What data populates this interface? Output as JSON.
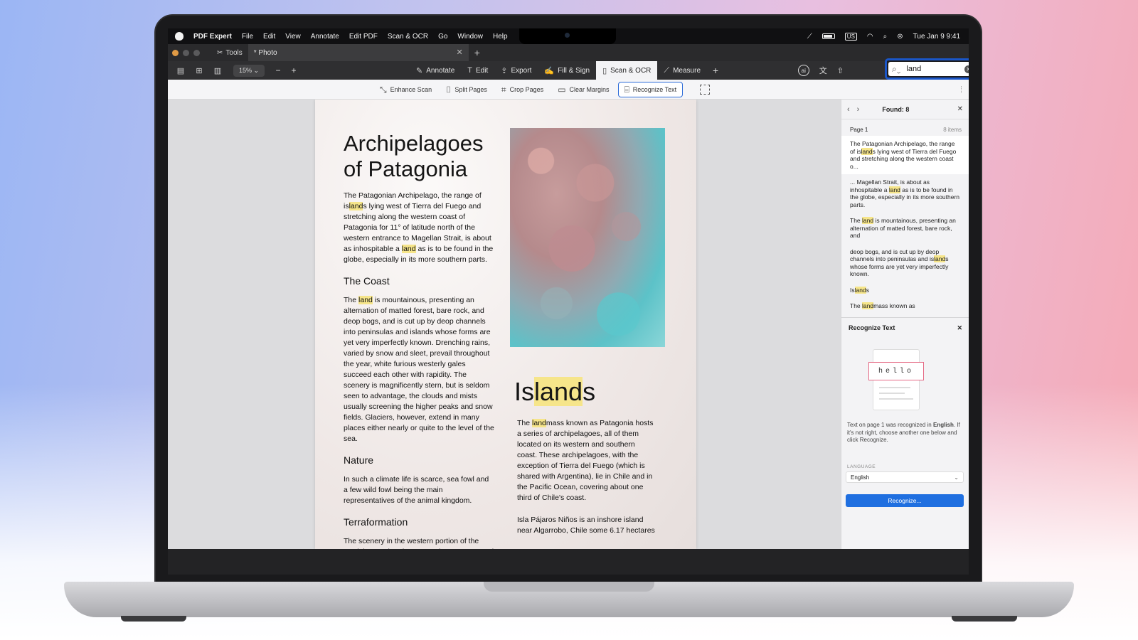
{
  "menubar": {
    "app_name": "PDF Expert",
    "items": [
      "File",
      "Edit",
      "View",
      "Annotate",
      "Edit PDF",
      "Scan & OCR",
      "Go",
      "Window",
      "Help"
    ],
    "keyboard_lang": "US",
    "clock": "Tue Jan 9  9:41"
  },
  "tabs": {
    "tools_label": "Tools",
    "doc_label": "* Photo"
  },
  "toolbar": {
    "zoom": "15%",
    "modes": [
      {
        "label": "Annotate",
        "icon": "pen-icon"
      },
      {
        "label": "Edit",
        "icon": "text-cursor-icon"
      },
      {
        "label": "Export",
        "icon": "upload-icon"
      },
      {
        "label": "Fill & Sign",
        "icon": "signature-icon"
      },
      {
        "label": "Scan & OCR",
        "icon": "scan-icon"
      },
      {
        "label": "Measure",
        "icon": "ruler-icon"
      }
    ],
    "active_mode": "Scan & OCR"
  },
  "search": {
    "value": "land"
  },
  "scan_tools": [
    {
      "label": "Enhance Scan"
    },
    {
      "label": "Split Pages"
    },
    {
      "label": "Crop Pages"
    },
    {
      "label": "Clear Margins"
    },
    {
      "label": "Recognize Text"
    }
  ],
  "document": {
    "title_line1": "Archipelagoes",
    "title_line2": "of Patagonia",
    "intro_a": "The Patagonian Archipelago, the range of is",
    "intro_hl": "land",
    "intro_b": "s lying west of Tierra del Fuego and stretching along the western coast of Patagonia for 11° of latitude north of the western entrance to Magellan Strait, is about as inhospitable a ",
    "intro_hl2": "land",
    "intro_c": " as is to be found in the globe, especially in its more southern parts.",
    "h_coast": "The Coast",
    "coast_a": "The ",
    "coast_hl": "land",
    "coast_b": " is mountainous, presenting an alternation of matted forest, bare rock, and deop bogs, and is cut up by deop channels into peninsulas and islands whose forms are yet very imperfectly known. Drenching rains, varied by snow and sleet, prevail throughout the year, white furious westerly gales succeed each other with rapidity. The scenery is magnificently stern, but is seldom seen to advantage, the clouds and mists usually screening the higher peaks and snow fields. Glaciers, however, extend in many places either nearly or quite to the level of the sea.",
    "h_nature": "Nature",
    "nature": "In such a climate life is scarce, sea fowl and a few wild fowl being the main representatives of the animal kingdom.",
    "h_terra": "Terraformation",
    "terra": "The scenery in the western portion of the Strait is grand and savage. The snow-capped",
    "islands_a": "Is",
    "islands_hl": "land",
    "islands_b": "s",
    "isl_p1_a": "The ",
    "isl_p1_hl": "land",
    "isl_p1_b": "mass known as Patagonia hosts a series of archipelagoes, all of them located on its western and southern coast. These archipelagoes, with the exception of Tierra del Fuego (which is shared with Argentina), lie in Chile and in the Pacific Ocean, covering about one third of Chile's coast.",
    "isl_p2": "Isla Pájaros Niños is an inshore island near Algarrobo, Chile some 6.17 hectares"
  },
  "find_panel": {
    "found_label": "Found: 8",
    "page_label": "Page 1",
    "count_label": "8 items",
    "results": [
      {
        "a": "The Patagonian Archipelago, the range of is",
        "hl": "land",
        "b": "s lying west of Tierra del Fuego and stretching along the western coast o..."
      },
      {
        "a": "... Magellan Strait, is about as inhospitable a ",
        "hl": "land",
        "b": " as is to be found in the globe, especially in its more southern parts."
      },
      {
        "a": "The ",
        "hl": "land",
        "b": " is mountainous, presenting an alternation of matted forest, bare rock, and"
      },
      {
        "a": "deop bogs, and is cut up by deop channels into peninsulas and is",
        "hl": "land",
        "b": "s whose forms are yet very imperfectly known."
      },
      {
        "a": "Is",
        "hl": "land",
        "b": "s"
      },
      {
        "a": "The ",
        "hl": "land",
        "b": "mass known as"
      }
    ]
  },
  "recognize_panel": {
    "title": "Recognize Text",
    "sample_word": "hello",
    "desc_a": "Text on page 1 was recognized in ",
    "desc_lang": "English",
    "desc_b": ". If it's not right, choose another one below and click Recognize.",
    "language_label": "LANGUAGE",
    "language_value": "English",
    "button_label": "Recognize..."
  }
}
